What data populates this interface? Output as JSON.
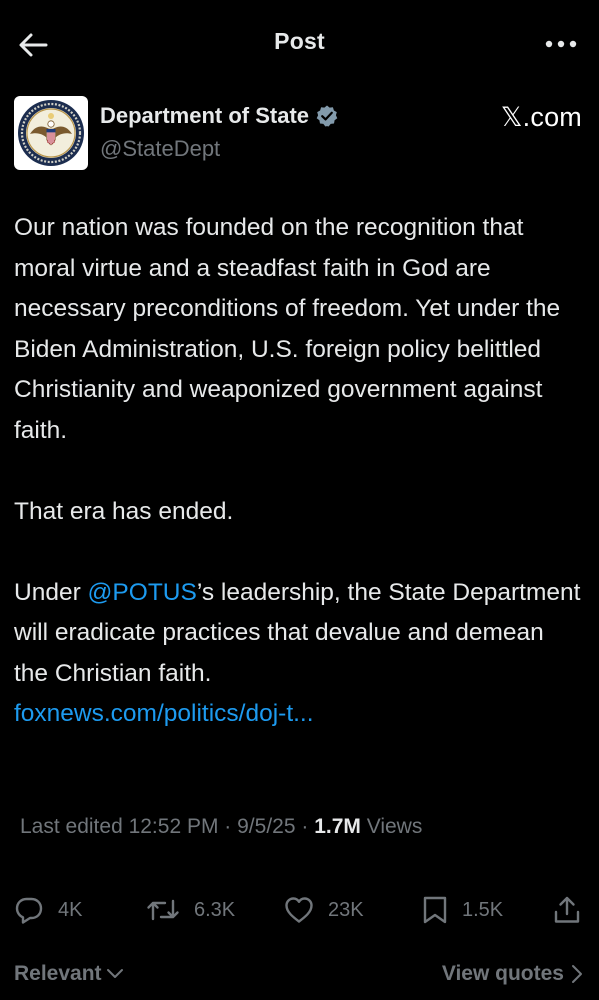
{
  "header": {
    "title": "Post",
    "back_icon": "arrow-left-icon",
    "more_icon": "more-horizontal-icon"
  },
  "author": {
    "name": "Department of State",
    "handle": "@StateDept",
    "verified_icon": "verified-badge-icon",
    "verified_color": "#829aab",
    "avatar_icon": "state-department-seal-icon",
    "source_label": "𝕏.com"
  },
  "post": {
    "paragraph1": "Our nation was founded on the recognition that moral virtue and a steadfast faith in God are necessary preconditions of freedom. Yet under the Biden Administration, U.S. foreign policy belittled Christianity and weaponized government against faith.",
    "paragraph2": "That era has ended.",
    "paragraph3_before": "Under ",
    "paragraph3_mention": "@POTUS",
    "paragraph3_after": "’s leadership, the State Department will eradicate practices that devalue and demean the Christian faith.",
    "link": "foxnews.com/politics/doj-t..."
  },
  "meta": {
    "edited": "Last edited 12:52 PM · 9/5/25",
    "separator": " · ",
    "views_count": "1.7M",
    "views_label": " Views"
  },
  "actions": {
    "replies": "4K",
    "reposts": "6.3K",
    "likes": "23K",
    "bookmarks": "1.5K",
    "icons": [
      "reply-icon",
      "repost-icon",
      "like-icon",
      "bookmark-icon",
      "share-icon"
    ]
  },
  "footer": {
    "sort_label": "Relevant",
    "view_quotes_label": "View quotes"
  },
  "colors": {
    "background": "#000000",
    "text": "#e7e9ea",
    "muted": "#71767b",
    "link": "#1d9bf0"
  }
}
